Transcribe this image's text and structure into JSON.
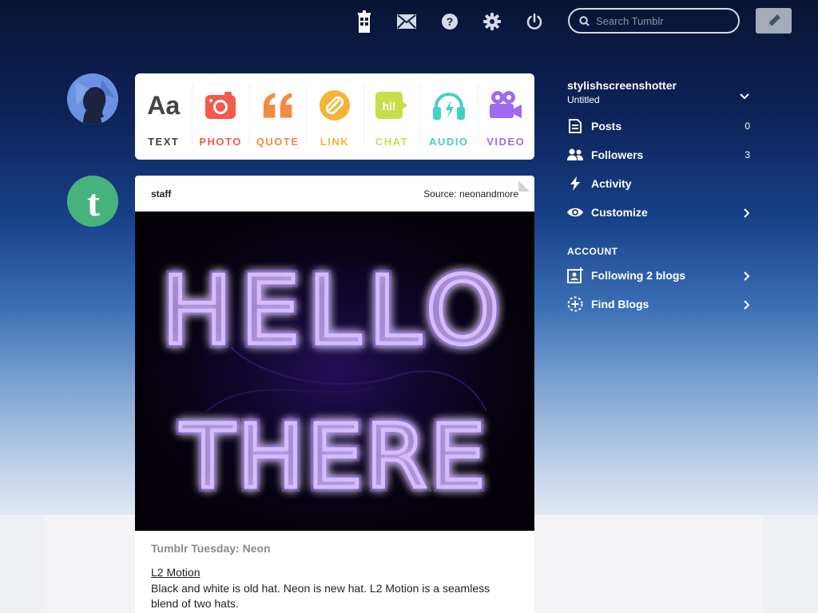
{
  "header": {
    "search_placeholder": "Search Tumblr",
    "icons": [
      "tardis-icon",
      "mail-icon",
      "help-icon",
      "gear-icon",
      "power-icon"
    ],
    "compose_icon": "pencil-icon"
  },
  "post_types": [
    {
      "label": "TEXT",
      "color": "#444444",
      "icon": "text-aa-icon",
      "glyph": "Aa"
    },
    {
      "label": "PHOTO",
      "color": "#f35a4a",
      "icon": "camera-icon"
    },
    {
      "label": "QUOTE",
      "color": "#f58a42",
      "icon": "quote-icon"
    },
    {
      "label": "LINK",
      "color": "#f6b334",
      "icon": "link-icon"
    },
    {
      "label": "CHAT",
      "color": "#c8dd4a",
      "icon": "chat-bubble-icon",
      "glyph": "hi!"
    },
    {
      "label": "AUDIO",
      "color": "#45d0c0",
      "icon": "headphones-icon"
    },
    {
      "label": "VIDEO",
      "color": "#a06af0",
      "icon": "video-camera-icon"
    }
  ],
  "post": {
    "author": "staff",
    "source": "Source: neonandmore",
    "image_text": [
      "HELLO",
      "THERE"
    ],
    "title": "Tumblr Tuesday: Neon",
    "link": "L2 Motion",
    "body": "Black and white is old hat. Neon is new hat. L2 Motion is a seamless blend of two hats."
  },
  "sidebar": {
    "blog_name": "stylishscreenshotter",
    "blog_subtitle": "Untitled",
    "items": [
      {
        "label": "Posts",
        "count": "0",
        "icon": "document-icon"
      },
      {
        "label": "Followers",
        "count": "3",
        "icon": "people-icon"
      },
      {
        "label": "Activity",
        "count": "",
        "icon": "lightning-icon"
      },
      {
        "label": "Customize",
        "count": "",
        "icon": "eye-icon"
      }
    ],
    "account_heading": "ACCOUNT",
    "account_items": [
      {
        "label": "Following 2 blogs",
        "icon": "follow-card-icon"
      },
      {
        "label": "Find Blogs",
        "icon": "find-blogs-icon"
      }
    ]
  },
  "colors": {
    "link_green": "#46b37d",
    "neon_purple": "#9f6bff"
  }
}
